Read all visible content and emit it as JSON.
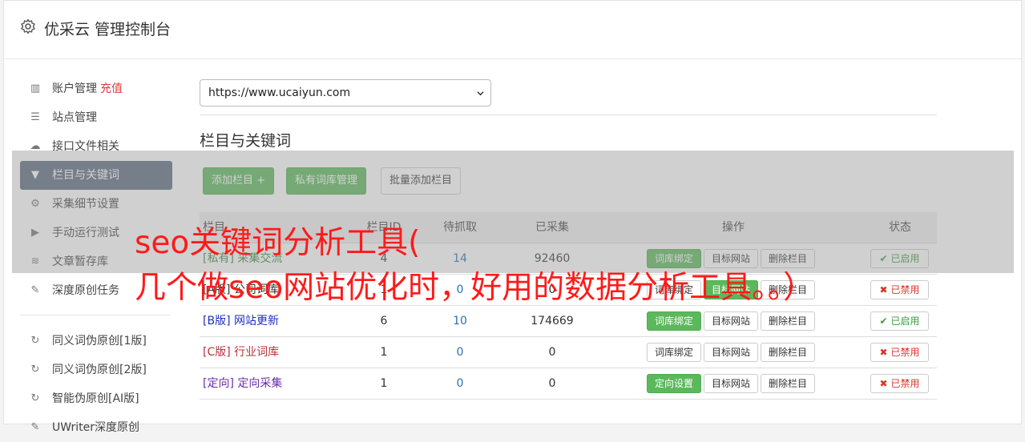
{
  "header": {
    "title": "优采云 管理控制台"
  },
  "sidebar": {
    "items": [
      {
        "label": "账户管理",
        "extra": "充值"
      },
      {
        "label": "站点管理"
      },
      {
        "label": "接口文件相关"
      },
      {
        "label": "栏目与关键词"
      },
      {
        "label": "采集细节设置"
      },
      {
        "label": "手动运行测试"
      },
      {
        "label": "文章暂存库"
      },
      {
        "label": "深度原创任务"
      }
    ],
    "items2": [
      {
        "label": "同义词伪原创[1版]"
      },
      {
        "label": "同义词伪原创[2版]"
      },
      {
        "label": "智能伪原创[AI版]"
      },
      {
        "label": "UWriter深度原创"
      }
    ]
  },
  "main": {
    "site_select": "https://www.ucaiyun.com",
    "section_title": "栏目与关键词",
    "buttons": {
      "add": "添加栏目 +",
      "private_lib": "私有词库管理",
      "batch_add": "批量添加栏目"
    }
  },
  "table": {
    "headers": {
      "name": "栏目",
      "cid": "栏目ID",
      "pending": "待抓取",
      "done": "已采集",
      "ops": "操作",
      "status": "状态"
    },
    "rows": [
      {
        "name": "[私有] 采集交流",
        "cid": "4",
        "pending": "14",
        "done": "92460",
        "op1": "词库绑定",
        "op2": "目标网站",
        "op3": "删除栏目",
        "status": "已启用"
      },
      {
        "name": "[A版] 公司词库",
        "cid": "1",
        "pending": "0",
        "done": "0",
        "op1": "词库绑定",
        "op2": "目标网站",
        "op3": "删除栏目",
        "status": "已禁用"
      },
      {
        "name": "[B版] 网站更新",
        "cid": "6",
        "pending": "10",
        "done": "174669",
        "op1": "词库绑定",
        "op2": "目标网站",
        "op3": "删除栏目",
        "status": "已启用"
      },
      {
        "name": "[C版] 行业词库",
        "cid": "1",
        "pending": "0",
        "done": "0",
        "op1": "词库绑定",
        "op2": "目标网站",
        "op3": "删除栏目",
        "status": "已禁用"
      },
      {
        "name": "[定向] 定向采集",
        "cid": "1",
        "pending": "0",
        "done": "0",
        "op1": "定向设置",
        "op2": "目标网站",
        "op3": "删除栏目",
        "status": "已禁用"
      }
    ]
  },
  "overlay": {
    "line1": "seo关键词分析工具(",
    "line2": "几个做seo网站优化时，好用的数据分析工具。。）"
  }
}
